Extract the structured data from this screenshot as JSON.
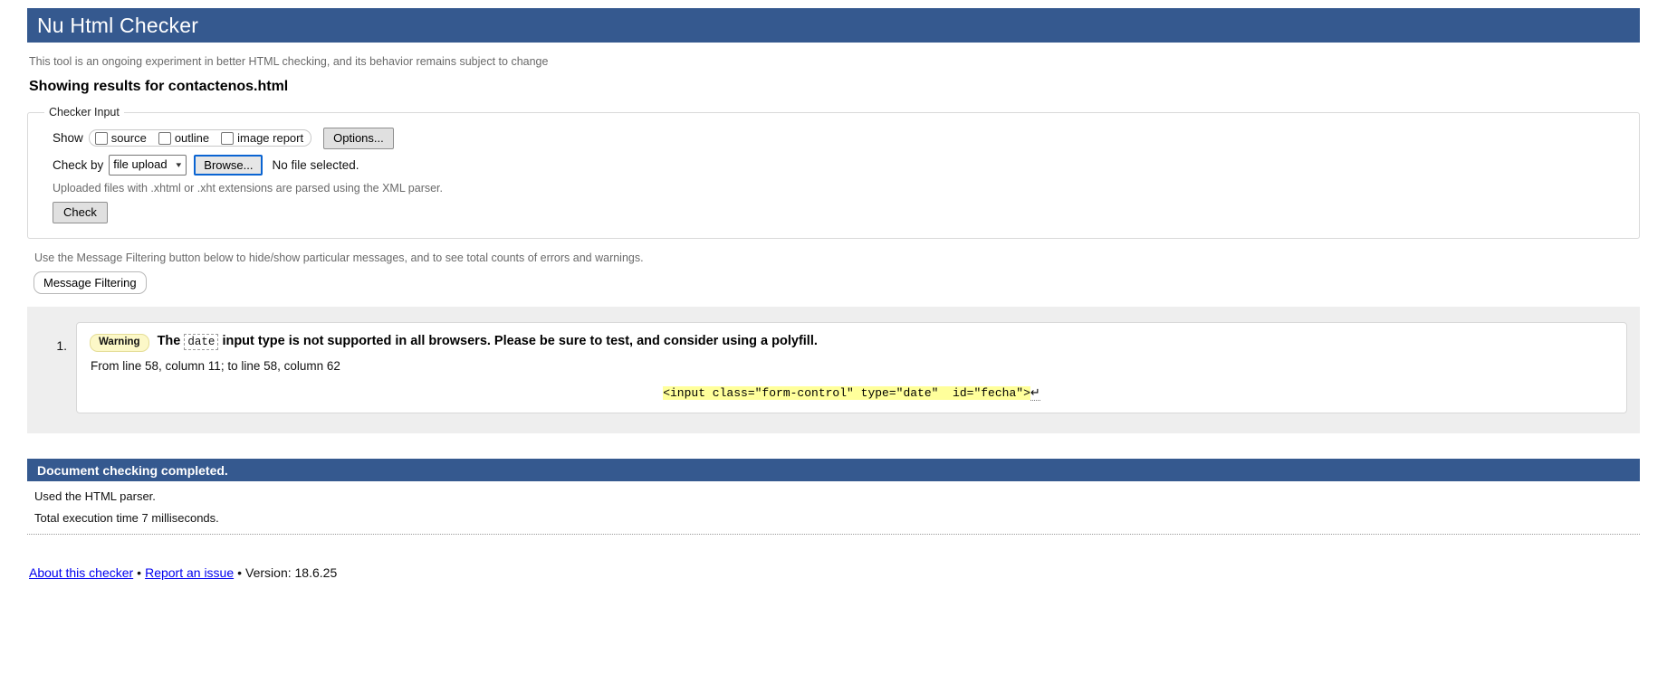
{
  "banner": {
    "title": "Nu Html Checker"
  },
  "intro": {
    "tool_note": "This tool is an ongoing experiment in better HTML checking, and its behavior remains subject to change",
    "results_heading": "Showing results for contactenos.html"
  },
  "checker_input": {
    "legend": "Checker Input",
    "show_label": "Show",
    "checkboxes": [
      {
        "label": "source"
      },
      {
        "label": "outline"
      },
      {
        "label": "image report"
      }
    ],
    "options_button": "Options...",
    "check_by_label": "Check by",
    "check_by_value": "file upload",
    "browse_button": "Browse...",
    "file_status": "No file selected.",
    "upload_note": "Uploaded files with .xhtml or .xht extensions are parsed using the XML parser.",
    "check_button": "Check"
  },
  "filtering": {
    "note": "Use the Message Filtering button below to hide/show particular messages, and to see total counts of errors and warnings.",
    "button": "Message Filtering"
  },
  "messages": [
    {
      "number": "1.",
      "badge": "Warning",
      "text_before": "The",
      "code_token": "date",
      "text_after": "input type is not supported in all browsers. Please be sure to test, and consider using a polyfill.",
      "location": "From line 58, column 11; to line 58, column 62",
      "extract": "<input class=\"form-control\" type=\"date\"  id=\"fecha\">",
      "extract_cr": "↵"
    }
  ],
  "completion": {
    "banner": "Document checking completed.",
    "parser_line": "Used the HTML parser.",
    "time_line": "Total execution time 7 milliseconds."
  },
  "footer": {
    "about_link": "About this checker",
    "report_link": "Report an issue",
    "separator": "•",
    "version": "Version: 18.6.25"
  },
  "colors": {
    "banner_blue": "#35598f",
    "warning_yellow": "#fcf8c8",
    "highlight_yellow": "#ffff9b",
    "results_bg": "#eeeeee",
    "link_blue": "#0000ee"
  }
}
